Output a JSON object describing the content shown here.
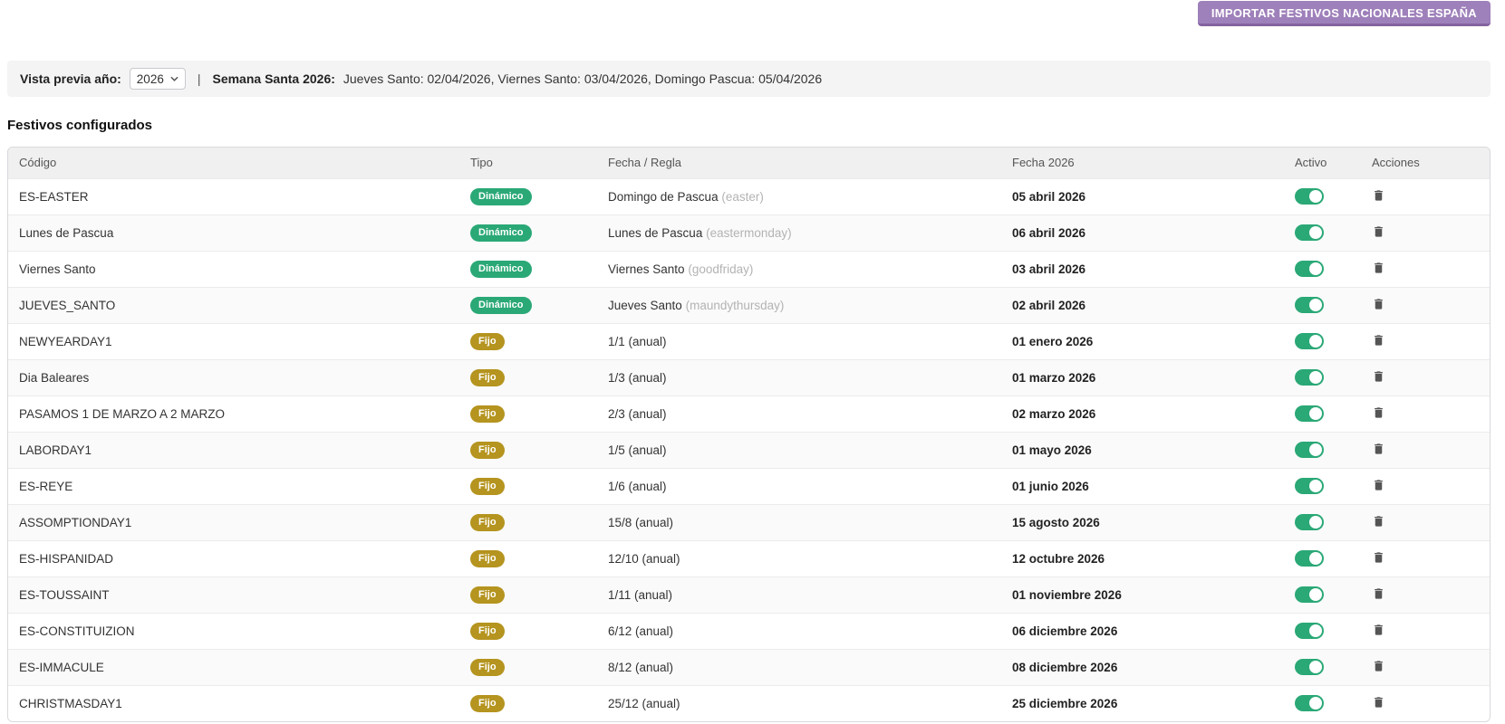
{
  "colors": {
    "accent_purple": "#9e80ba",
    "accent_purple_dark": "#84639f",
    "toggle_on": "#2aa876",
    "badge": {
      "Dinámico": "#2aa876",
      "Fijo": "#b5941f"
    }
  },
  "header": {
    "import_button_label": "IMPORTAR FESTIVOS NACIONALES ESPAÑA"
  },
  "preview_bar": {
    "label": "Vista previa año:",
    "year": "2026",
    "separator": "|",
    "semana_santa_label": "Semana Santa 2026:",
    "semana_santa_text": "Jueves Santo: 02/04/2026, Viernes Santo: 03/04/2026, Domingo Pascua: 05/04/2026"
  },
  "section_title": "Festivos configurados",
  "table": {
    "columns": [
      "Código",
      "Tipo",
      "Fecha / Regla",
      "Fecha 2026",
      "Activo",
      "Acciones"
    ],
    "rows": [
      {
        "codigo": "ES-EASTER",
        "tipo": "Dinámico",
        "regla": "Domingo de Pascua",
        "regla_code": "(easter)",
        "fecha": "05 abril 2026",
        "activo": true
      },
      {
        "codigo": "Lunes de Pascua",
        "tipo": "Dinámico",
        "regla": "Lunes de Pascua",
        "regla_code": "(eastermonday)",
        "fecha": "06 abril 2026",
        "activo": true
      },
      {
        "codigo": "Viernes Santo",
        "tipo": "Dinámico",
        "regla": "Viernes Santo",
        "regla_code": "(goodfriday)",
        "fecha": "03 abril 2026",
        "activo": true
      },
      {
        "codigo": "JUEVES_SANTO",
        "tipo": "Dinámico",
        "regla": "Jueves Santo",
        "regla_code": "(maundythursday)",
        "fecha": "02 abril 2026",
        "activo": true
      },
      {
        "codigo": "NEWYEARDAY1",
        "tipo": "Fijo",
        "regla": "1/1 (anual)",
        "regla_code": "",
        "fecha": "01 enero 2026",
        "activo": true
      },
      {
        "codigo": "Dia Baleares",
        "tipo": "Fijo",
        "regla": "1/3 (anual)",
        "regla_code": "",
        "fecha": "01 marzo 2026",
        "activo": true
      },
      {
        "codigo": "PASAMOS 1 DE MARZO A 2 MARZO",
        "tipo": "Fijo",
        "regla": "2/3 (anual)",
        "regla_code": "",
        "fecha": "02 marzo 2026",
        "activo": true
      },
      {
        "codigo": "LABORDAY1",
        "tipo": "Fijo",
        "regla": "1/5 (anual)",
        "regla_code": "",
        "fecha": "01 mayo 2026",
        "activo": true
      },
      {
        "codigo": "ES-REYE",
        "tipo": "Fijo",
        "regla": "1/6 (anual)",
        "regla_code": "",
        "fecha": "01 junio 2026",
        "activo": true
      },
      {
        "codigo": "ASSOMPTIONDAY1",
        "tipo": "Fijo",
        "regla": "15/8 (anual)",
        "regla_code": "",
        "fecha": "15 agosto 2026",
        "activo": true
      },
      {
        "codigo": "ES-HISPANIDAD",
        "tipo": "Fijo",
        "regla": "12/10 (anual)",
        "regla_code": "",
        "fecha": "12 octubre 2026",
        "activo": true
      },
      {
        "codigo": "ES-TOUSSAINT",
        "tipo": "Fijo",
        "regla": "1/11 (anual)",
        "regla_code": "",
        "fecha": "01 noviembre 2026",
        "activo": true
      },
      {
        "codigo": "ES-CONSTITUIZION",
        "tipo": "Fijo",
        "regla": "6/12 (anual)",
        "regla_code": "",
        "fecha": "06 diciembre 2026",
        "activo": true
      },
      {
        "codigo": "ES-IMMACULE",
        "tipo": "Fijo",
        "regla": "8/12 (anual)",
        "regla_code": "",
        "fecha": "08 diciembre 2026",
        "activo": true
      },
      {
        "codigo": "CHRISTMASDAY1",
        "tipo": "Fijo",
        "regla": "25/12 (anual)",
        "regla_code": "",
        "fecha": "25 diciembre 2026",
        "activo": true
      }
    ]
  }
}
